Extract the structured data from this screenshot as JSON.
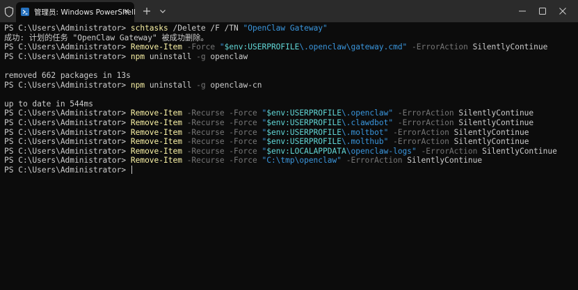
{
  "window": {
    "tab_title": "管理员: Windows PowerShell",
    "tab_close_glyph": "✕",
    "buttons": [
      "new-tab",
      "dropdown",
      "minimize",
      "maximize",
      "close"
    ],
    "icons": {
      "shield": "shield-icon",
      "tab": "powershell-icon",
      "new_tab": "plus-icon",
      "dropdown": "chevron-down-icon",
      "minimize": "minimize-icon",
      "maximize": "maximize-icon",
      "close": "close-icon"
    },
    "colors": {
      "titlebar": "#2b2b2b",
      "background": "#0c0c0c",
      "text": "#cccccc",
      "command": "#f9f1a5",
      "parameter": "#767676",
      "string": "#3a96dd",
      "variable": "#61d6d6"
    }
  },
  "terminal": {
    "lines": [
      [
        {
          "t": "PS C:\\Users\\Administrator> ",
          "c": "plain"
        },
        {
          "t": "schtasks",
          "c": "cmd"
        },
        {
          "t": " /Delete /F /TN ",
          "c": "plain"
        },
        {
          "t": "\"OpenClaw Gateway\"",
          "c": "string"
        }
      ],
      [
        {
          "t": "成功: 计划的任务 \"OpenClaw Gateway\" 被成功删除。",
          "c": "plain"
        }
      ],
      [
        {
          "t": "PS C:\\Users\\Administrator> ",
          "c": "plain"
        },
        {
          "t": "Remove-Item",
          "c": "cmd"
        },
        {
          "t": " -Force ",
          "c": "param"
        },
        {
          "t": "\"",
          "c": "string"
        },
        {
          "t": "$env:USERPROFILE",
          "c": "var"
        },
        {
          "t": "\\.openclaw\\gateway.cmd\"",
          "c": "string"
        },
        {
          "t": " -ErrorAction ",
          "c": "param"
        },
        {
          "t": "SilentlyContinue",
          "c": "plain"
        }
      ],
      [
        {
          "t": "PS C:\\Users\\Administrator> ",
          "c": "plain"
        },
        {
          "t": "npm",
          "c": "cmd"
        },
        {
          "t": " uninstall ",
          "c": "plain"
        },
        {
          "t": "-g",
          "c": "param"
        },
        {
          "t": " openclaw",
          "c": "plain"
        }
      ],
      [],
      [
        {
          "t": "removed 662 packages in 13s",
          "c": "plain"
        }
      ],
      [
        {
          "t": "PS C:\\Users\\Administrator> ",
          "c": "plain"
        },
        {
          "t": "npm",
          "c": "cmd"
        },
        {
          "t": " uninstall ",
          "c": "plain"
        },
        {
          "t": "-g",
          "c": "param"
        },
        {
          "t": " openclaw-cn",
          "c": "plain"
        }
      ],
      [],
      [
        {
          "t": "up to date in 544ms",
          "c": "plain"
        }
      ],
      [
        {
          "t": "PS C:\\Users\\Administrator> ",
          "c": "plain"
        },
        {
          "t": "Remove-Item",
          "c": "cmd"
        },
        {
          "t": " -Recurse -Force ",
          "c": "param"
        },
        {
          "t": "\"",
          "c": "string"
        },
        {
          "t": "$env:USERPROFILE",
          "c": "var"
        },
        {
          "t": "\\.openclaw\"",
          "c": "string"
        },
        {
          "t": " -ErrorAction ",
          "c": "param"
        },
        {
          "t": "SilentlyContinue",
          "c": "plain"
        }
      ],
      [
        {
          "t": "PS C:\\Users\\Administrator> ",
          "c": "plain"
        },
        {
          "t": "Remove-Item",
          "c": "cmd"
        },
        {
          "t": " -Recurse -Force ",
          "c": "param"
        },
        {
          "t": "\"",
          "c": "string"
        },
        {
          "t": "$env:USERPROFILE",
          "c": "var"
        },
        {
          "t": "\\.clawdbot\"",
          "c": "string"
        },
        {
          "t": " -ErrorAction ",
          "c": "param"
        },
        {
          "t": "SilentlyContinue",
          "c": "plain"
        }
      ],
      [
        {
          "t": "PS C:\\Users\\Administrator> ",
          "c": "plain"
        },
        {
          "t": "Remove-Item",
          "c": "cmd"
        },
        {
          "t": " -Recurse -Force ",
          "c": "param"
        },
        {
          "t": "\"",
          "c": "string"
        },
        {
          "t": "$env:USERPROFILE",
          "c": "var"
        },
        {
          "t": "\\.moltbot\"",
          "c": "string"
        },
        {
          "t": " -ErrorAction ",
          "c": "param"
        },
        {
          "t": "SilentlyContinue",
          "c": "plain"
        }
      ],
      [
        {
          "t": "PS C:\\Users\\Administrator> ",
          "c": "plain"
        },
        {
          "t": "Remove-Item",
          "c": "cmd"
        },
        {
          "t": " -Recurse -Force ",
          "c": "param"
        },
        {
          "t": "\"",
          "c": "string"
        },
        {
          "t": "$env:USERPROFILE",
          "c": "var"
        },
        {
          "t": "\\.molthub\"",
          "c": "string"
        },
        {
          "t": " -ErrorAction ",
          "c": "param"
        },
        {
          "t": "SilentlyContinue",
          "c": "plain"
        }
      ],
      [
        {
          "t": "PS C:\\Users\\Administrator> ",
          "c": "plain"
        },
        {
          "t": "Remove-Item",
          "c": "cmd"
        },
        {
          "t": " -Recurse -Force ",
          "c": "param"
        },
        {
          "t": "\"",
          "c": "string"
        },
        {
          "t": "$env:LOCALAPPDATA",
          "c": "var"
        },
        {
          "t": "\\openclaw-logs\"",
          "c": "string"
        },
        {
          "t": " -ErrorAction ",
          "c": "param"
        },
        {
          "t": "SilentlyContinue",
          "c": "plain"
        }
      ],
      [
        {
          "t": "PS C:\\Users\\Administrator> ",
          "c": "plain"
        },
        {
          "t": "Remove-Item",
          "c": "cmd"
        },
        {
          "t": " -Recurse -Force ",
          "c": "param"
        },
        {
          "t": "\"C:\\tmp\\openclaw\"",
          "c": "string"
        },
        {
          "t": " -ErrorAction ",
          "c": "param"
        },
        {
          "t": "SilentlyContinue",
          "c": "plain"
        }
      ],
      [
        {
          "t": "PS C:\\Users\\Administrator> ",
          "c": "plain"
        },
        {
          "cursor": true
        }
      ]
    ]
  }
}
